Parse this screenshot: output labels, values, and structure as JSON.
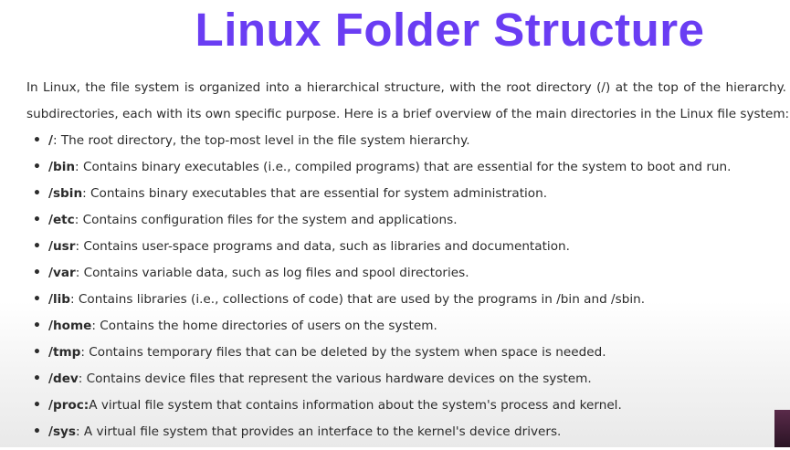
{
  "title": "Linux Folder Structure",
  "colors": {
    "title": "#6a3df3"
  },
  "intro": {
    "line1": "In Linux, the file system is organized into a hierarchical structure, with the root directory (/) at the top of the hierarchy.",
    "line2": "subdirectories, each with its own specific purpose. Here is a brief overview of the main directories in the Linux file system:"
  },
  "bullet_glyph": "•",
  "items": [
    {
      "dir": "/",
      "desc": ": The root directory, the top-most level in the file system hierarchy."
    },
    {
      "dir": "/bin",
      "desc": ": Contains binary executables (i.e., compiled programs) that are essential for the system to boot and run."
    },
    {
      "dir": "/sbin",
      "desc": ": Contains binary executables that are essential for system administration."
    },
    {
      "dir": "/etc",
      "desc": ": Contains configuration files for the system and applications."
    },
    {
      "dir": "/usr",
      "desc": ": Contains user-space programs and data, such as libraries and documentation."
    },
    {
      "dir": "/var",
      "desc": ": Contains variable data, such as log files and spool directories."
    },
    {
      "dir": "/lib",
      "desc": ": Contains libraries (i.e., collections of code) that are used by the programs in /bin and /sbin."
    },
    {
      "dir": "/home",
      "desc": ": Contains the home directories of users on the system."
    },
    {
      "dir": "/tmp",
      "desc": ": Contains temporary files that can be deleted by the system when space is needed."
    },
    {
      "dir": "/dev",
      "desc": ": Contains device files that represent the various hardware devices on the system."
    },
    {
      "dir": "/proc:",
      "desc": " A virtual file system that contains information about the system's process and kernel."
    },
    {
      "dir": "/sys",
      "desc": ": A virtual file system that provides an interface to the kernel's device drivers."
    }
  ]
}
